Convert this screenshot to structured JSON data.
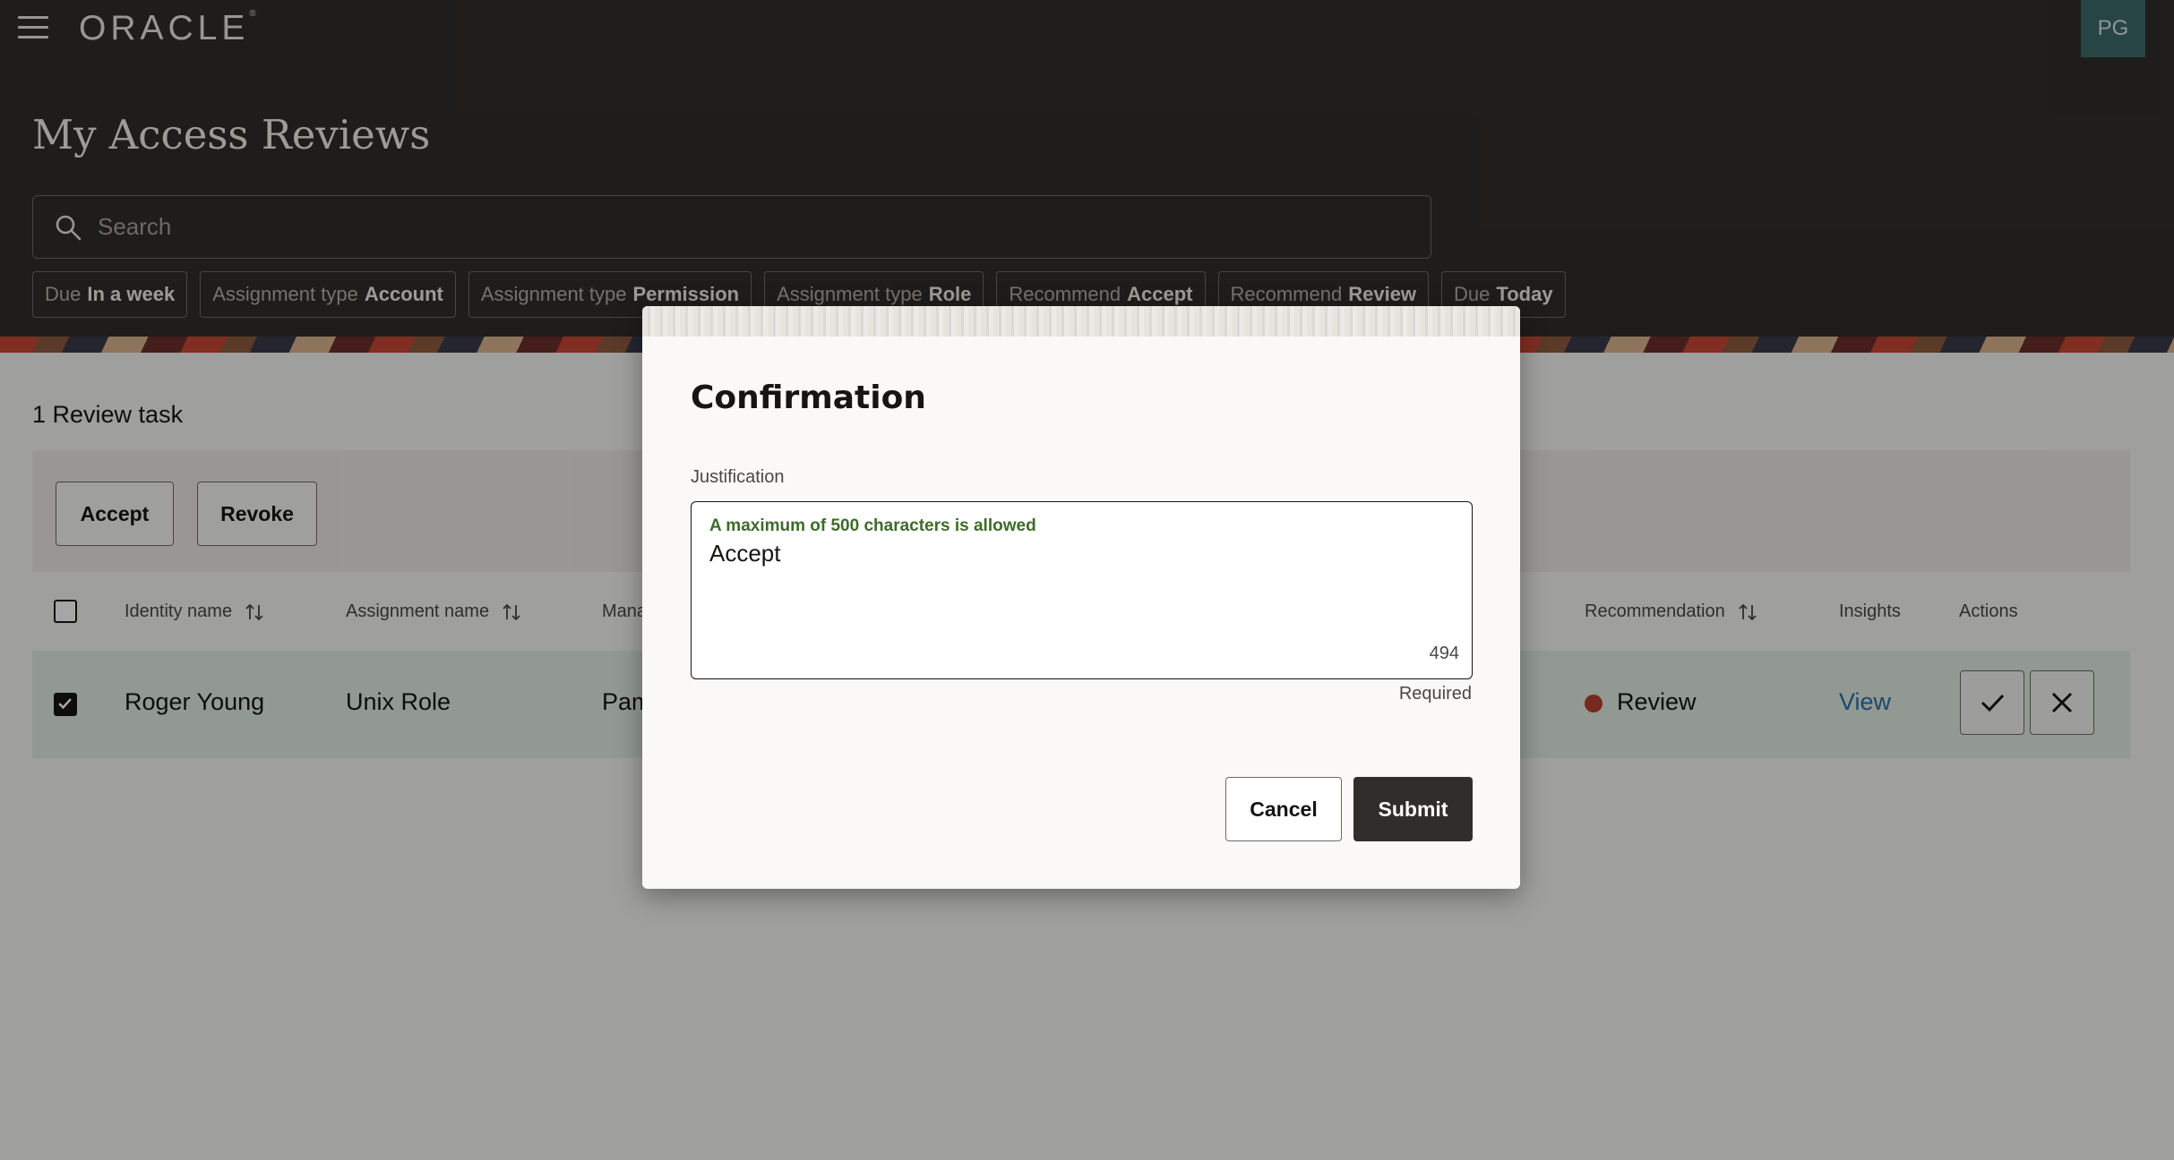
{
  "app": {
    "brand": "ORACLE",
    "avatar_initials": "PG",
    "page_title": "My Access Reviews"
  },
  "search": {
    "placeholder": "Search"
  },
  "filters": [
    {
      "prefix": "Due",
      "value": "In a week"
    },
    {
      "prefix": "Assignment type",
      "value": "Account"
    },
    {
      "prefix": "Assignment type",
      "value": "Permission"
    },
    {
      "prefix": "Assignment type",
      "value": "Role"
    },
    {
      "prefix": "Recommend",
      "value": "Accept"
    },
    {
      "prefix": "Recommend",
      "value": "Review"
    },
    {
      "prefix": "Due",
      "value": "Today"
    }
  ],
  "content": {
    "count_label": "1 Review task",
    "accept_label": "Accept",
    "revoke_label": "Revoke"
  },
  "table": {
    "headers": {
      "identity": "Identity name",
      "assignment": "Assignment name",
      "manager": "Mana",
      "recommendation": "Recommendation",
      "insights": "Insights",
      "actions": "Actions"
    },
    "rows": [
      {
        "identity": "Roger Young",
        "assignment": "Unix Role",
        "manager": "Pam",
        "recommendation": "Review",
        "insights": "View",
        "selected": true
      }
    ]
  },
  "dialog": {
    "title": "Confirmation",
    "field_label": "Justification",
    "hint": "A maximum of 500 characters is allowed",
    "value": "Accept",
    "remaining": "494",
    "required_label": "Required",
    "cancel_label": "Cancel",
    "submit_label": "Submit"
  },
  "colors": {
    "header_bg": "#312d2a",
    "selected_row": "#dfece0",
    "review_dot": "#b43f30",
    "link": "#2b6fa8",
    "hint_text": "#3d6b2a"
  }
}
